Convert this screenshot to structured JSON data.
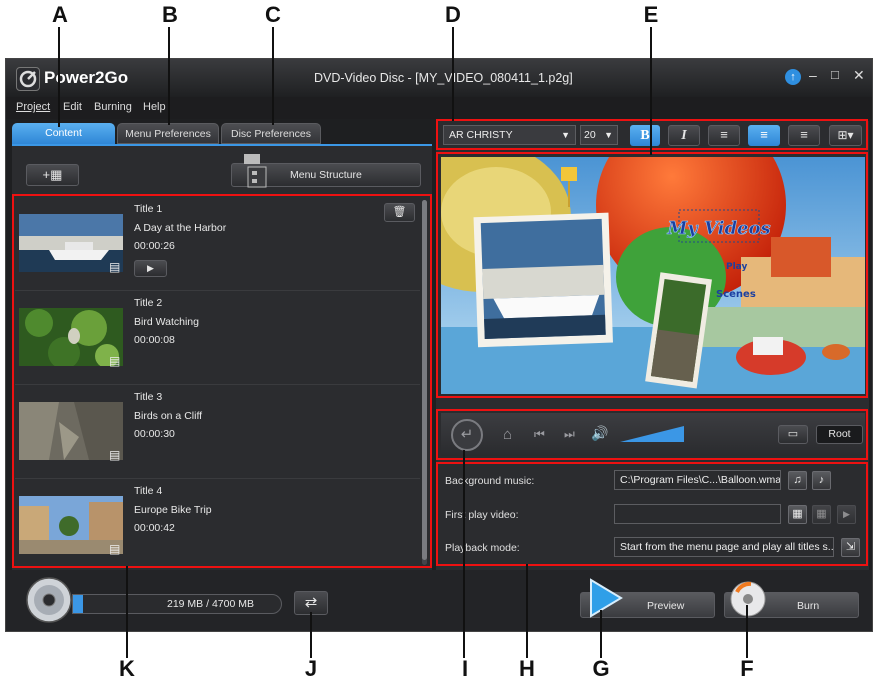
{
  "callouts": [
    "A",
    "B",
    "C",
    "D",
    "E",
    "K",
    "J",
    "I",
    "H",
    "G",
    "F"
  ],
  "app": {
    "logo": "Power2Go",
    "title": "DVD-Video Disc - [MY_VIDEO_080411_1.p2g]"
  },
  "menu": [
    "Project",
    "Edit",
    "Burning",
    "Help"
  ],
  "tabs": [
    "Content",
    "Menu Preferences",
    "Disc Preferences"
  ],
  "menu_structure_label": "Menu Structure",
  "titles": [
    {
      "title": "Title 1",
      "name": "A Day at the Harbor",
      "duration": "00:00:26"
    },
    {
      "title": "Title 2",
      "name": "Bird Watching",
      "duration": "00:00:08"
    },
    {
      "title": "Title 3",
      "name": "Birds on a Cliff",
      "duration": "00:00:30"
    },
    {
      "title": "Title 4",
      "name": "Europe Bike Trip",
      "duration": "00:00:42"
    }
  ],
  "font_toolbar": {
    "font": "AR CHRISTY",
    "size": "20",
    "bold": "B",
    "italic": "I"
  },
  "preview": {
    "heading": "My Videos",
    "play": "Play",
    "scenes": "Scenes"
  },
  "nav": {
    "root": "Root"
  },
  "settings": {
    "background_music_label": "Background music:",
    "background_music_value": "C:\\Program Files\\C...\\Balloon.wma",
    "first_play_label": "First play video:",
    "first_play_value": "",
    "playback_label": "Playback mode:",
    "playback_value": "Start from the menu page and play all titles s..."
  },
  "disc_usage": {
    "text": "219 MB / 4700 MB",
    "fraction": 0.0466
  },
  "buttons": {
    "preview": "Preview",
    "burn": "Burn"
  },
  "colors": {
    "accent": "#2f8fe0",
    "highlight": "#e11111"
  }
}
